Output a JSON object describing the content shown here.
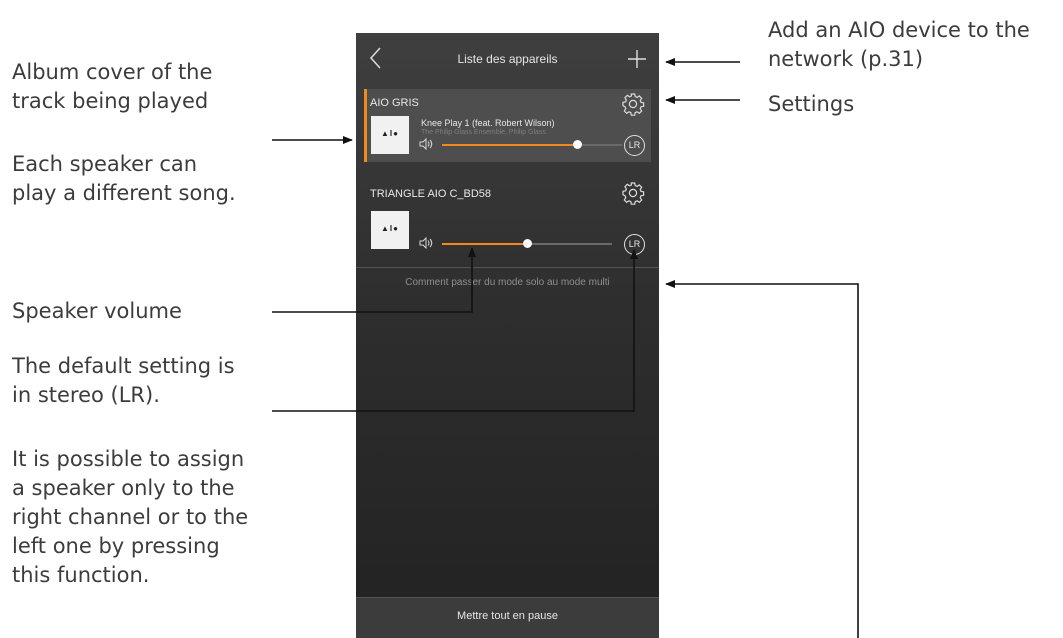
{
  "annotations": {
    "album_cover": "Album cover of the\ntrack being played",
    "each_speaker": "Each speaker can\nplay a different song.",
    "add_device": "Add an AIO device to the\nnetwork (p.31)",
    "settings": "Settings",
    "speaker_volume": "Speaker volume",
    "stereo_default": "The default setting is\nin stereo (LR).",
    "assign_channel": "It is possible to assign\na speaker only to the\nright channel or to the\nleft one by pressing\nthis function."
  },
  "app": {
    "nav": {
      "title": "Liste des appareils",
      "back_icon": "chevron-left-icon",
      "add_icon": "plus-icon"
    },
    "devices": [
      {
        "name": "AIO GRIS",
        "cover_text": "▲I●",
        "track": "Knee Play 1 (feat. Robert Wilson)",
        "artist": "The Philip Glass Ensemble, Philip Glass",
        "volume": 0.75,
        "channel": "LR",
        "selected": true
      },
      {
        "name": "TRIANGLE AIO C_BD58",
        "cover_text": "▲I●",
        "volume": 0.5,
        "channel": "LR",
        "selected": false
      }
    ],
    "help_link": "Comment passer du mode solo au mode multi",
    "footer_button": "Mettre tout en pause"
  },
  "colors": {
    "accent": "#f0891e",
    "background": "#2e2e2e",
    "card": "#4e4e4e"
  }
}
